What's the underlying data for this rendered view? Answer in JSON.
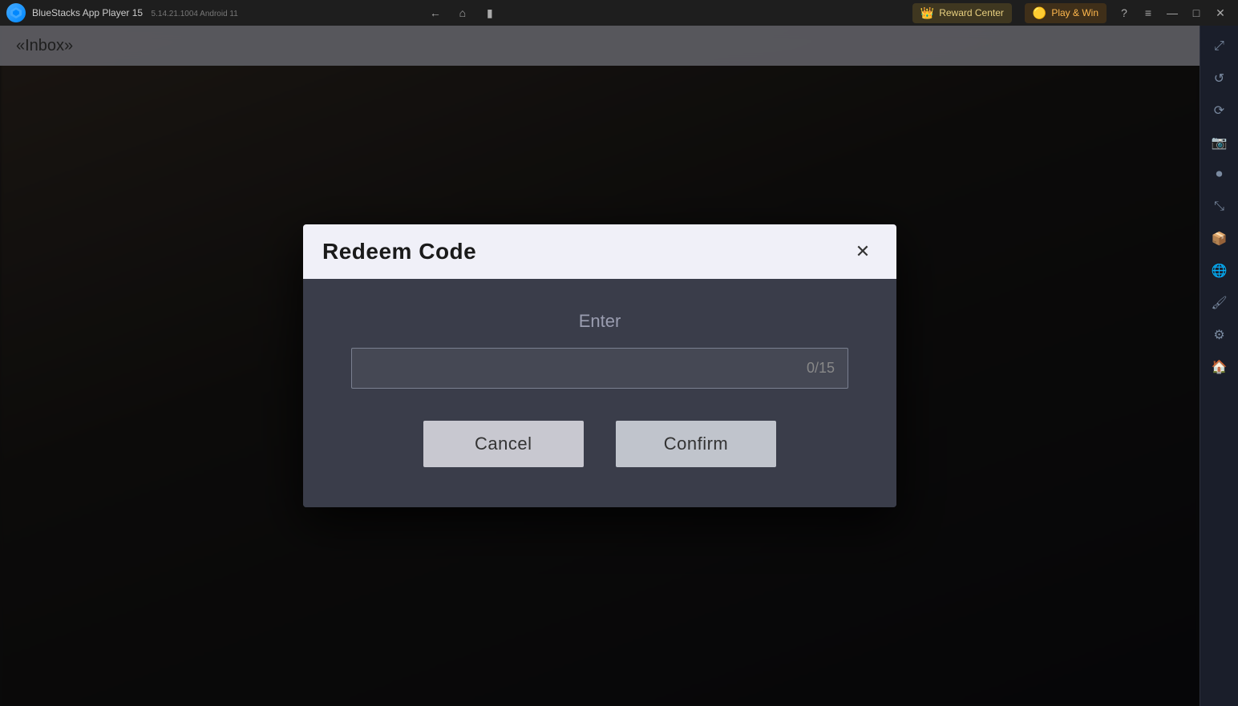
{
  "titlebar": {
    "app_name": "BlueStacks App Player 15",
    "app_version": "5.14.21.1004  Android 11",
    "reward_center_label": "Reward Center",
    "play_win_label": "Play & Win",
    "nav": {
      "back_title": "Back",
      "home_title": "Home",
      "copy_title": "Copy"
    },
    "window_controls": {
      "help": "?",
      "menu": "≡",
      "minimize": "—",
      "maximize": "□",
      "close": "✕",
      "sidebar_expand": "⤢"
    }
  },
  "sidebar": {
    "icons": [
      {
        "name": "expand-icon",
        "glyph": "⤢"
      },
      {
        "name": "refresh-icon",
        "glyph": "↺"
      },
      {
        "name": "rotate-icon",
        "glyph": "⟳"
      },
      {
        "name": "screenshot-icon",
        "glyph": "📷"
      },
      {
        "name": "camera-icon",
        "glyph": "🎬"
      },
      {
        "name": "zoom-icon",
        "glyph": "⤡"
      },
      {
        "name": "settings-icon",
        "glyph": "⚙"
      },
      {
        "name": "apk-icon",
        "glyph": "📦"
      },
      {
        "name": "globe-icon",
        "glyph": "🌐"
      },
      {
        "name": "brush-icon",
        "glyph": "🖌"
      },
      {
        "name": "settings2-icon",
        "glyph": "⚙"
      },
      {
        "name": "home2-icon",
        "glyph": "🏠"
      }
    ]
  },
  "game_top_bar": {
    "text": "«Inbox»"
  },
  "modal": {
    "title": "Redeem Code",
    "close_label": "✕",
    "enter_label": "Enter",
    "input_placeholder": "",
    "input_counter": "0/15",
    "cancel_label": "Cancel",
    "confirm_label": "Confirm"
  }
}
